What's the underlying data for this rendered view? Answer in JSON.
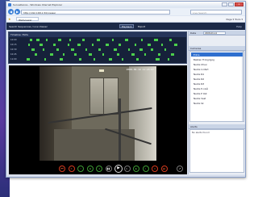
{
  "browser": {
    "title": "Surveillance - Windows Internet Explorer",
    "url": "http://192.168.1.50/viewer",
    "search_placeholder": "Live Search",
    "tab_label": "Webviewer",
    "tools_label": "Page ▾ Tools ▾"
  },
  "app": {
    "crumb": "Search Sequences / Live Viewer",
    "btn_playback": "Playback",
    "btn_export": "Export",
    "help_label": "Help"
  },
  "timeline": {
    "title": "Timeline: Exits",
    "rows": [
      {
        "label": "10:00",
        "segments": [
          [
            0.06,
            0.015
          ],
          [
            0.1,
            0.02
          ],
          [
            0.16,
            0.01
          ],
          [
            0.23,
            0.02
          ],
          [
            0.3,
            0.01
          ],
          [
            0.38,
            0.015
          ],
          [
            0.47,
            0.02
          ],
          [
            0.56,
            0.01
          ],
          [
            0.64,
            0.02
          ],
          [
            0.74,
            0.01
          ],
          [
            0.82,
            0.02
          ],
          [
            0.91,
            0.015
          ]
        ]
      },
      {
        "label": "10:15",
        "segments": [
          [
            0.05,
            0.01
          ],
          [
            0.12,
            0.02
          ],
          [
            0.2,
            0.015
          ],
          [
            0.29,
            0.01
          ],
          [
            0.35,
            0.02
          ],
          [
            0.44,
            0.01
          ],
          [
            0.52,
            0.02
          ],
          [
            0.6,
            0.015
          ],
          [
            0.7,
            0.01
          ],
          [
            0.78,
            0.02
          ],
          [
            0.86,
            0.01
          ],
          [
            0.94,
            0.02
          ]
        ]
      },
      {
        "label": "10:30",
        "segments": [
          [
            0.07,
            0.02
          ],
          [
            0.14,
            0.01
          ],
          [
            0.22,
            0.015
          ],
          [
            0.31,
            0.02
          ],
          [
            0.4,
            0.01
          ],
          [
            0.48,
            0.015
          ],
          [
            0.57,
            0.02
          ],
          [
            0.66,
            0.01
          ],
          [
            0.73,
            0.02
          ],
          [
            0.8,
            0.015
          ],
          [
            0.88,
            0.01
          ]
        ]
      },
      {
        "label": "10:45",
        "segments": [
          [
            0.09,
            0.015
          ],
          [
            0.18,
            0.02
          ],
          [
            0.26,
            0.01
          ],
          [
            0.33,
            0.015
          ],
          [
            0.42,
            0.02
          ],
          [
            0.5,
            0.01
          ],
          [
            0.59,
            0.015
          ],
          [
            0.68,
            0.02
          ],
          [
            0.76,
            0.01
          ],
          [
            0.84,
            0.015
          ],
          [
            0.92,
            0.02
          ]
        ]
      },
      {
        "label": "11:00",
        "segments": [
          [
            0.04,
            0.02
          ],
          [
            0.15,
            0.01
          ],
          [
            0.24,
            0.02
          ],
          [
            0.36,
            0.015
          ],
          [
            0.45,
            0.01
          ],
          [
            0.54,
            0.02
          ],
          [
            0.62,
            0.01
          ],
          [
            0.71,
            0.015
          ],
          [
            0.83,
            0.02
          ],
          [
            0.9,
            0.01
          ]
        ]
      }
    ]
  },
  "video": {
    "osd": "2008-09-14 11:23:07"
  },
  "controls": [
    {
      "name": "skip-start-button",
      "glyph": "⏮",
      "style": "red"
    },
    {
      "name": "rewind-fast-button",
      "glyph": "«",
      "style": "red"
    },
    {
      "name": "rewind-button",
      "glyph": "‹",
      "style": "grn"
    },
    {
      "name": "prev-frame-button",
      "glyph": "◂",
      "style": "grn"
    },
    {
      "name": "step-back-button",
      "glyph": "◃",
      "style": "grn"
    },
    {
      "name": "pause-button",
      "glyph": "▮▮",
      "style": "plain"
    },
    {
      "name": "play-button",
      "glyph": "▶",
      "style": "play"
    },
    {
      "name": "step-forward-button",
      "glyph": "▹",
      "style": "plain"
    },
    {
      "name": "next-frame-button",
      "glyph": "▸",
      "style": "grn"
    },
    {
      "name": "forward-button",
      "glyph": "›",
      "style": "grn"
    },
    {
      "name": "forward-fast-button",
      "glyph": "»",
      "style": "red"
    },
    {
      "name": "skip-end-button",
      "glyph": "⏭",
      "style": "red"
    }
  ],
  "sidebar": {
    "date_label": "Date",
    "date_value": "2008-09-14",
    "cameras_title": "Cameras",
    "cameras": [
      "Entre",
      "Bakken Frokgrigog",
      "Nedre Utvei",
      "Nedre Innfart",
      "Nedre N1",
      "Nedre N2",
      "Nedre N3",
      "Nedre P-nivå",
      "Nedre P Ost",
      "Nedre Vest",
      "Nedre Sk"
    ],
    "selected_index": 0,
    "alerts_title": "Alerts",
    "alerts_text": "No alerts found"
  }
}
